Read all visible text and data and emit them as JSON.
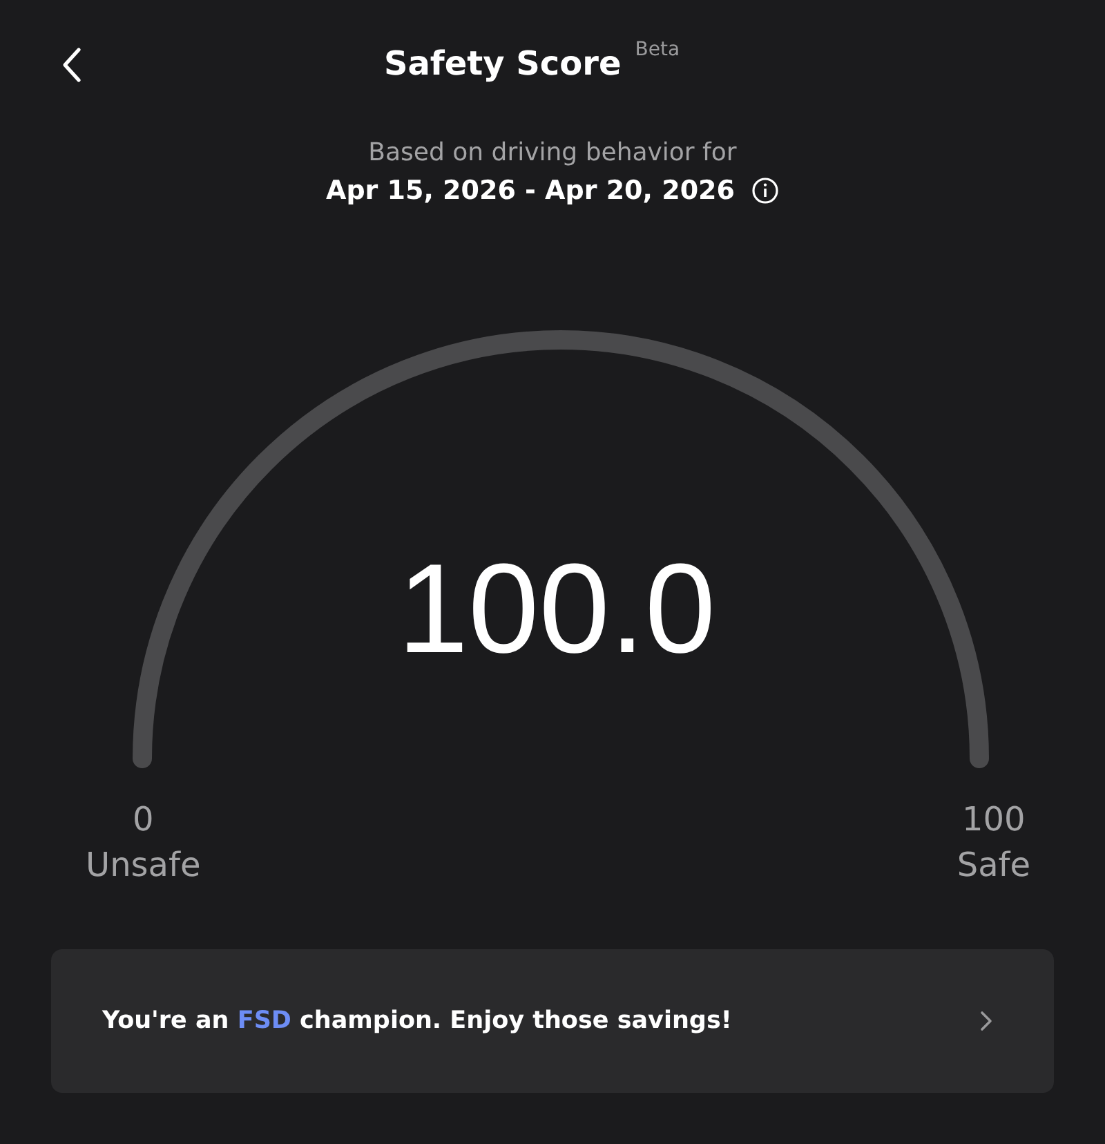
{
  "header": {
    "title": "Safety Score",
    "badge": "Beta"
  },
  "period": {
    "caption": "Based on driving behavior for",
    "range": "Apr 15, 2026 - Apr 20, 2026"
  },
  "gauge": {
    "score": "100.0",
    "min_value": "0",
    "min_label": "Unsafe",
    "max_value": "100",
    "max_label": "Safe"
  },
  "banner": {
    "parts": [
      {
        "kind": "text",
        "text": "You're an "
      },
      {
        "kind": "link",
        "text": "FSD"
      },
      {
        "kind": "text",
        "text": " champion. Enjoy those savings!"
      }
    ]
  }
}
